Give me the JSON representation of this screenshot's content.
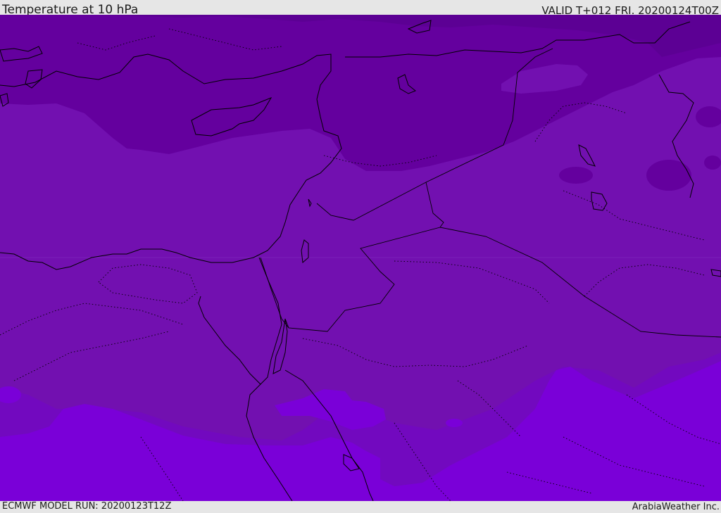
{
  "header": {
    "title": "Temperature at 10 hPa",
    "valid_time": "VALID T+012 FRI. 20200124T00Z"
  },
  "footer": {
    "model_run": "ECMWF MODEL RUN: 20200123T12Z",
    "credit": "ArabiaWeather Inc."
  },
  "colors": {
    "band_coldest": "#5a0090",
    "band_cold": "#64009e",
    "band_mid": "#7210b0",
    "band_warm": "#7a00d8",
    "coastline": "#000000",
    "border": "#000000"
  }
}
